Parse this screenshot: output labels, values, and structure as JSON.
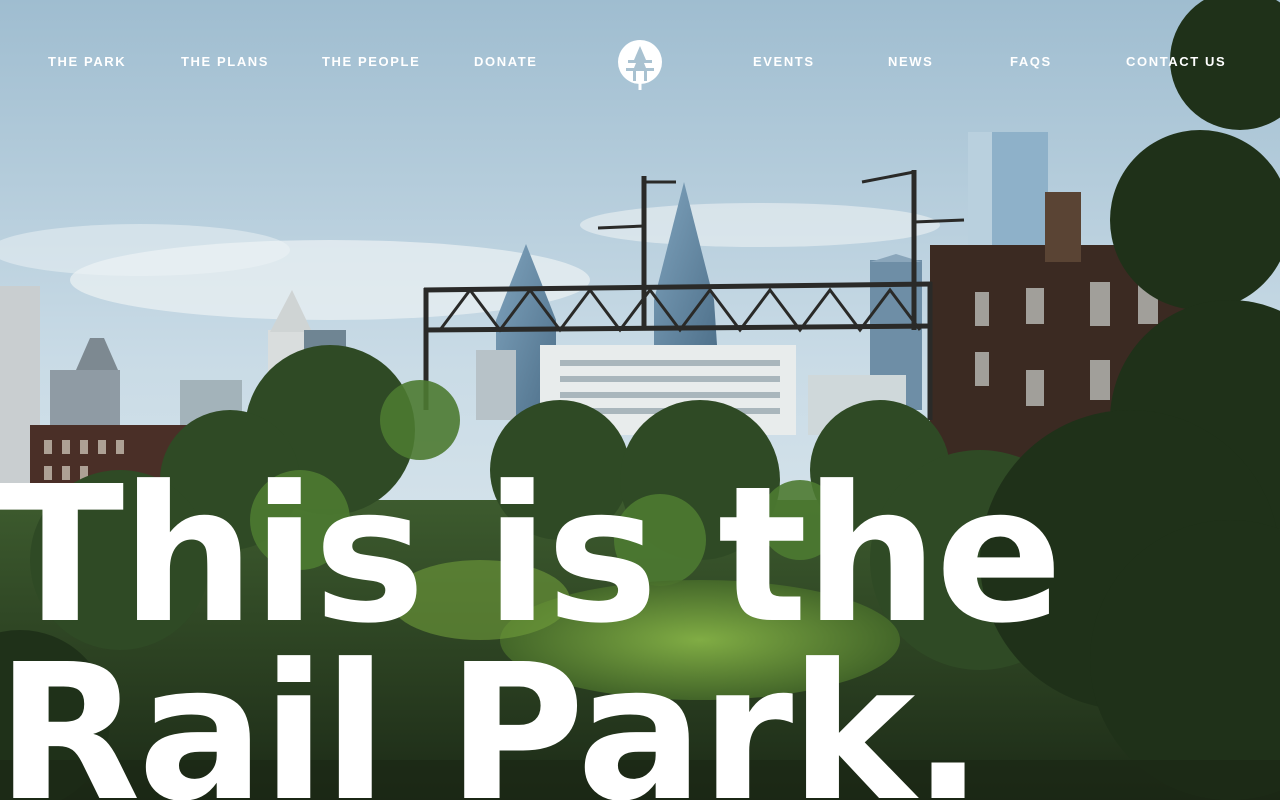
{
  "nav": {
    "left": [
      {
        "label": "THE PARK"
      },
      {
        "label": "THE PLANS"
      },
      {
        "label": "THE PEOPLE"
      },
      {
        "label": "DONATE"
      }
    ],
    "right": [
      {
        "label": "EVENTS"
      },
      {
        "label": "NEWS"
      },
      {
        "label": "FAQS"
      },
      {
        "label": "CONTACT US"
      }
    ],
    "logo_icon": "rail-park-tree-logo-icon"
  },
  "hero": {
    "line1": "This is the",
    "line2": "Rail Park."
  },
  "colors": {
    "text": "#ffffff",
    "sky": "#cfe0ea",
    "foliage": "#2c4a24"
  }
}
